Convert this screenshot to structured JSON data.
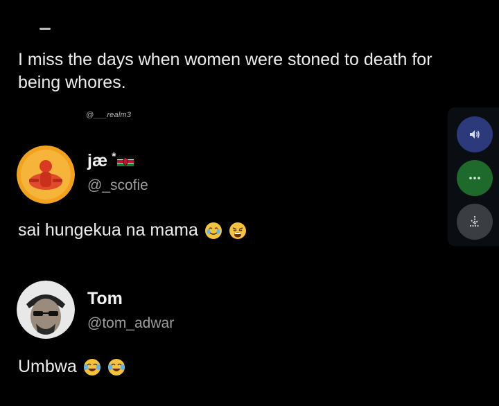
{
  "tweet": {
    "text": "I miss the days when women were stoned to death for being whores.",
    "watermark": "@___realm3"
  },
  "replies": [
    {
      "display_name": "jæ",
      "name_suffix": "*",
      "flag_icon": "kenya-flag-icon",
      "handle": "@_scofie",
      "text": "sai hungekua na mama",
      "emojis": [
        "grimacing-tears-emoji",
        "weary-face-emoji"
      ]
    },
    {
      "display_name": "Tom",
      "handle": "@tom_adwar",
      "text": "Umbwa",
      "emojis": [
        "tears-of-joy-emoji",
        "tears-of-joy-emoji"
      ]
    }
  ],
  "side_buttons": [
    {
      "icon": "speaker-icon",
      "color": "#2c3a7c"
    },
    {
      "icon": "more-dots-icon",
      "color": "#1e6a2c"
    },
    {
      "icon": "download-icon",
      "color": "#3a3d42"
    }
  ]
}
